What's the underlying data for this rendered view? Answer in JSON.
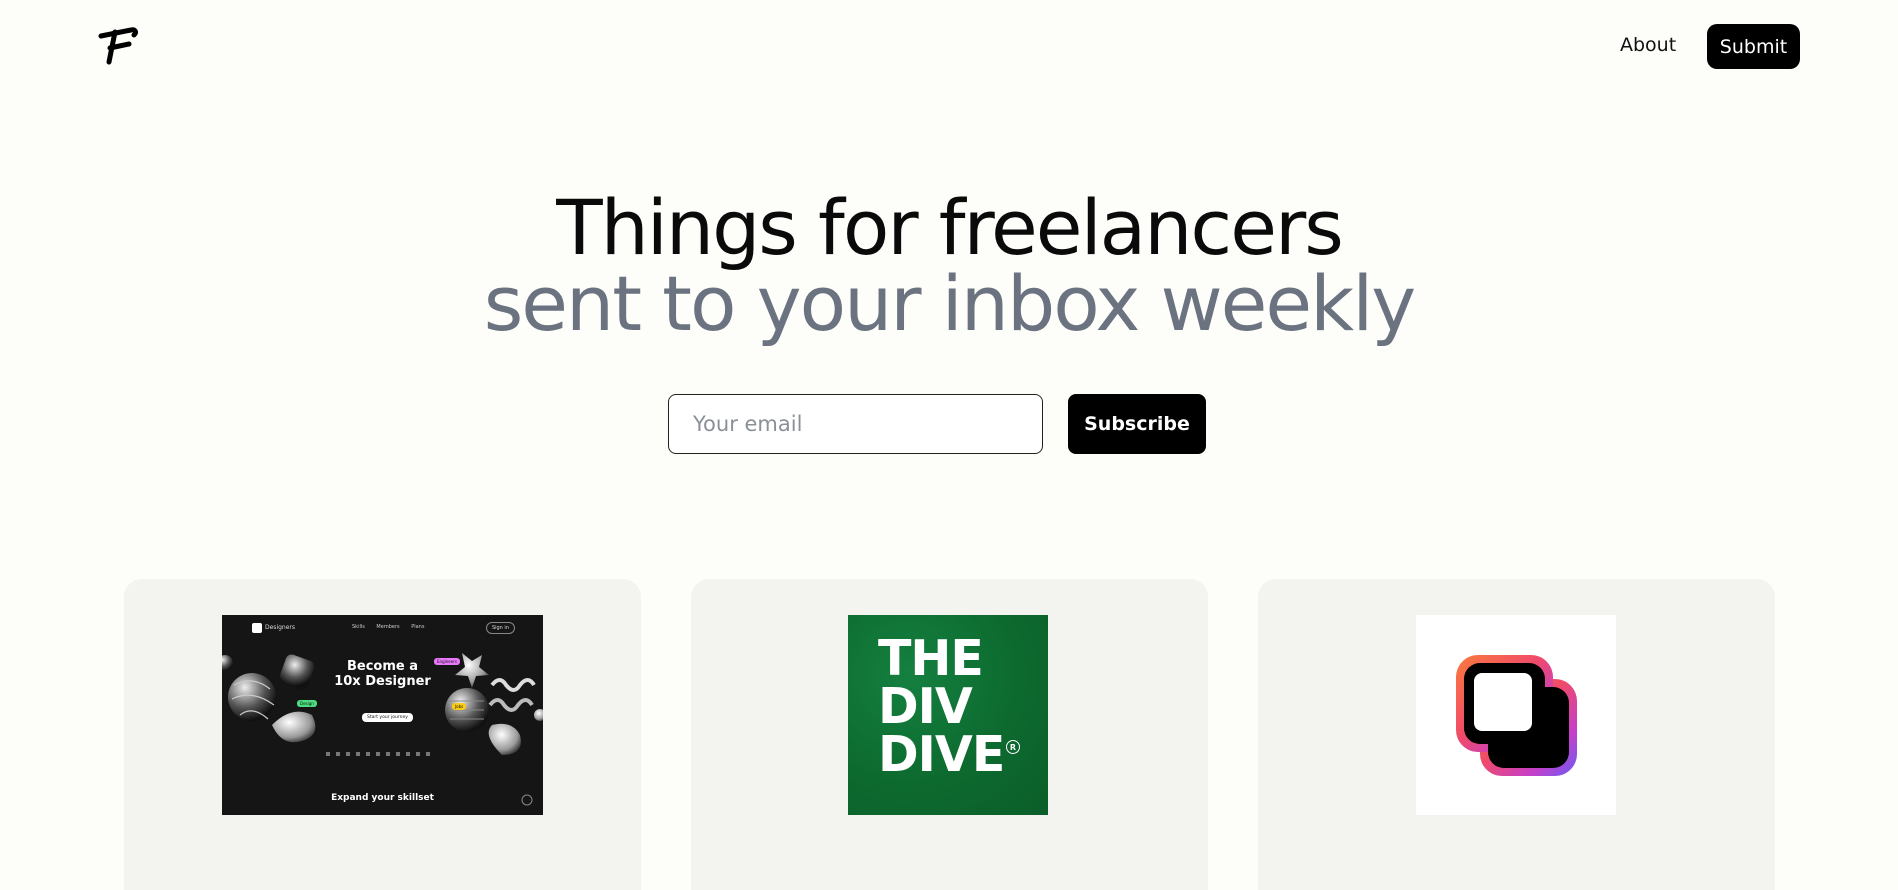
{
  "header": {
    "logo_icon": "f-logo-icon",
    "nav": {
      "about_label": "About",
      "submit_label": "Submit"
    }
  },
  "hero": {
    "title": "Things for freelancers",
    "subtitle": "sent to your inbox weekly",
    "email_placeholder": "Your email",
    "subscribe_label": "Subscribe"
  },
  "cards": [
    {
      "thumbnail": {
        "brand": "Designers",
        "nav_links": "Skills Members Plans",
        "sign_in": "Sign in",
        "headline_line1": "Become a",
        "headline_line2": "10x Designer",
        "cta": "Start your journey",
        "section_heading": "Expand your skillset",
        "pill_1": "Engineers",
        "pill_2": "Design",
        "pill_3": "Jobs"
      }
    },
    {
      "thumbnail": {
        "line1": "THE",
        "line2": "DIV",
        "line3": "DIVE",
        "registered": "R"
      }
    },
    {
      "thumbnail": {
        "icon": "overlapping-squares-app-icon"
      }
    }
  ],
  "colors": {
    "background": "#fdfdf9",
    "card_background": "#f3f4f0",
    "subtitle_gray": "#6b7280",
    "button_black": "#000000",
    "divdive_green": "#0e6b31"
  }
}
